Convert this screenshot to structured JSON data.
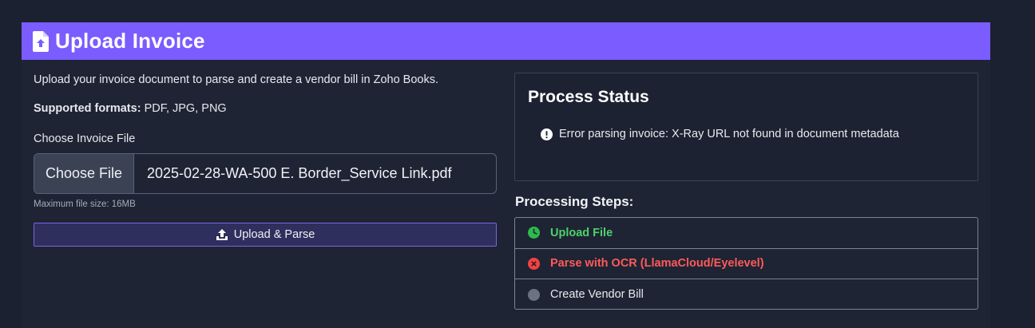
{
  "header": {
    "title": "Upload Invoice",
    "icon": "file-upload-icon",
    "color": "#7a5cff"
  },
  "upload": {
    "intro": "Upload your invoice document to parse and create a vendor bill in Zoho Books.",
    "formats_label": "Supported formats:",
    "formats_value": "PDF, JPG, PNG",
    "choose_label": "Choose Invoice File",
    "choose_button": "Choose File",
    "file_name": "2025-02-28-WA-500 E. Border_Service Link.pdf",
    "max_size": "Maximum file size: 16MB",
    "submit_label": "Upload & Parse",
    "submit_icon": "upload-icon"
  },
  "status": {
    "title": "Process Status",
    "message": "Error parsing invoice: X-Ray URL not found in document metadata",
    "message_icon": "exclamation-circle-icon"
  },
  "steps": {
    "title": "Processing Steps:",
    "items": [
      {
        "label": "Upload File",
        "state": "done",
        "color": "#4fd16b",
        "icon": "check-circle-icon"
      },
      {
        "label": "Parse with OCR (LlamaCloud/Eyelevel)",
        "state": "error",
        "color": "#ff5a5a",
        "icon": "x-circle-icon"
      },
      {
        "label": "Create Vendor Bill",
        "state": "pending",
        "color": "#6b7280",
        "icon": "circle-icon"
      }
    ]
  }
}
